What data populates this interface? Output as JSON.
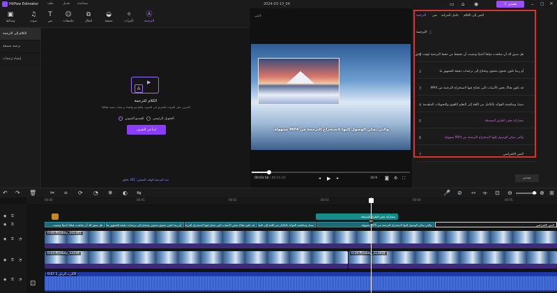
{
  "app": {
    "name": "HitPaw Edimakor",
    "menu": [
      "ملف",
      "تعديل",
      "مساعدة"
    ],
    "project_title": "2024-03-13_04",
    "export_label": "تصدير"
  },
  "toolbar": {
    "items": [
      {
        "label": "وسائط",
        "icon": "media-icon"
      },
      {
        "label": "صوت",
        "icon": "music-icon"
      },
      {
        "label": "نص",
        "icon": "text-icon"
      },
      {
        "label": "ملصقات",
        "icon": "sticker-icon"
      },
      {
        "label": "انتقال",
        "icon": "transition-icon"
      },
      {
        "label": "تصفية",
        "icon": "filter-icon"
      },
      {
        "label": "تأثيرات",
        "icon": "effects-icon"
      },
      {
        "label": "الترجمة",
        "icon": "subtitle-icon"
      }
    ]
  },
  "leftnav": {
    "items": [
      "الكلام إلى الترجمة",
      "ترجمة مسبقة",
      "إنشاء ترجمات"
    ]
  },
  "panel": {
    "title": "الكلام للترجمة",
    "desc1": "التعرف على الصوت البشري في الصوت والفيديو وإنشاء ترجمات نصية تلقائيًا.",
    "desc2": "",
    "option_auto": "الفيديو الصوتي",
    "option_manual": "التحويل الرئيسي",
    "start_button": "ابدأ في التعرف",
    "footer": "مدة الترجمة الوقت المتبقي: 241 دقائق"
  },
  "preview": {
    "label": "لاعب",
    "caption": "والتي يمكن الوصول إليها لاستخراج الترجمة من MP4 بسهولة.",
    "time_current": "00:03:18",
    "time_total": "00:11:25",
    "zoom": "16:9",
    "progress": 0.11
  },
  "right": {
    "tabs": [
      "النص إلى الكلام",
      "عامل المركبة",
      "نص",
      "الترجمة"
    ],
    "section": "الترجمة",
    "rows": [
      {
        "n": "1",
        "text": "هل سبق لك أن شاهدت فيلمًا أجنبيًا وتمنيت أن تحتفظ من حفظ الترجمة لوقت لاحق؟",
        "pink": false
      },
      {
        "n": "2",
        "text": "أو ربما تكون تحتوي محتوى وتحتاج إلى ترجمات دقيقة للجمهور ما.",
        "pink": false
      },
      {
        "n": "3",
        "text": "قد تكون هناك بعض الأسباب التي تحتاج فيها لاستخراج الترجمة من MP4",
        "pink": false
      },
      {
        "n": "4",
        "text": "سننا، ومناقشة الفوائد بالكامل من اللغة إلى التعلم اللغوي والتحويلات المتقدمة",
        "pink": false
      },
      {
        "n": "5",
        "text": "مشاركة بعض الطرق البسيطة",
        "pink": true
      },
      {
        "n": "6",
        "text": "والتي يمكن الوصول إليها لاستخراج الترجمة من MP4 بسهولة.",
        "pink": true
      },
      {
        "n": "7",
        "text": "النص الافتراضي",
        "pink": false
      }
    ],
    "export_small": "تصدير"
  },
  "timeline": {
    "ruler": [
      "00:00",
      "00:01",
      "00:02",
      "00:03",
      "00:04",
      "00:05"
    ],
    "text_clip": "مشاركة بعض الطرق البسيطة",
    "subtitles": [
      "هل سبق لك أن شاهدت فيلمًا أجنبيًا وتمنيت",
      "أو ربما تكون تحتوي محتوى وتحتاج إلى ترجمات دقيقة للجمهور ما",
      "قد تكون هناك بعض الأسباب التي تحتاج فيها لاستخراج الترجمة من MP4",
      "سننا، ومناقشة الفوائد بالكامل من اللغة إلى التعلم اللغوي والتحويلات المتقدمة",
      "والتي يمكن الوصول إليها لاستخراج الترجمة من MP4 بسهولة",
      "النص الافتراضي"
    ],
    "clip1": "0:06 Pixabay_205345",
    "clip2": "0:03 Pixabay_33194",
    "clip3": "0:28 Pixabay_213459",
    "audio": "الآثارت الرنان 1 0:07"
  },
  "colors": {
    "accent": "#9b4dff",
    "subtitle_pink": "#d06adf",
    "highlight": "#e03030"
  }
}
